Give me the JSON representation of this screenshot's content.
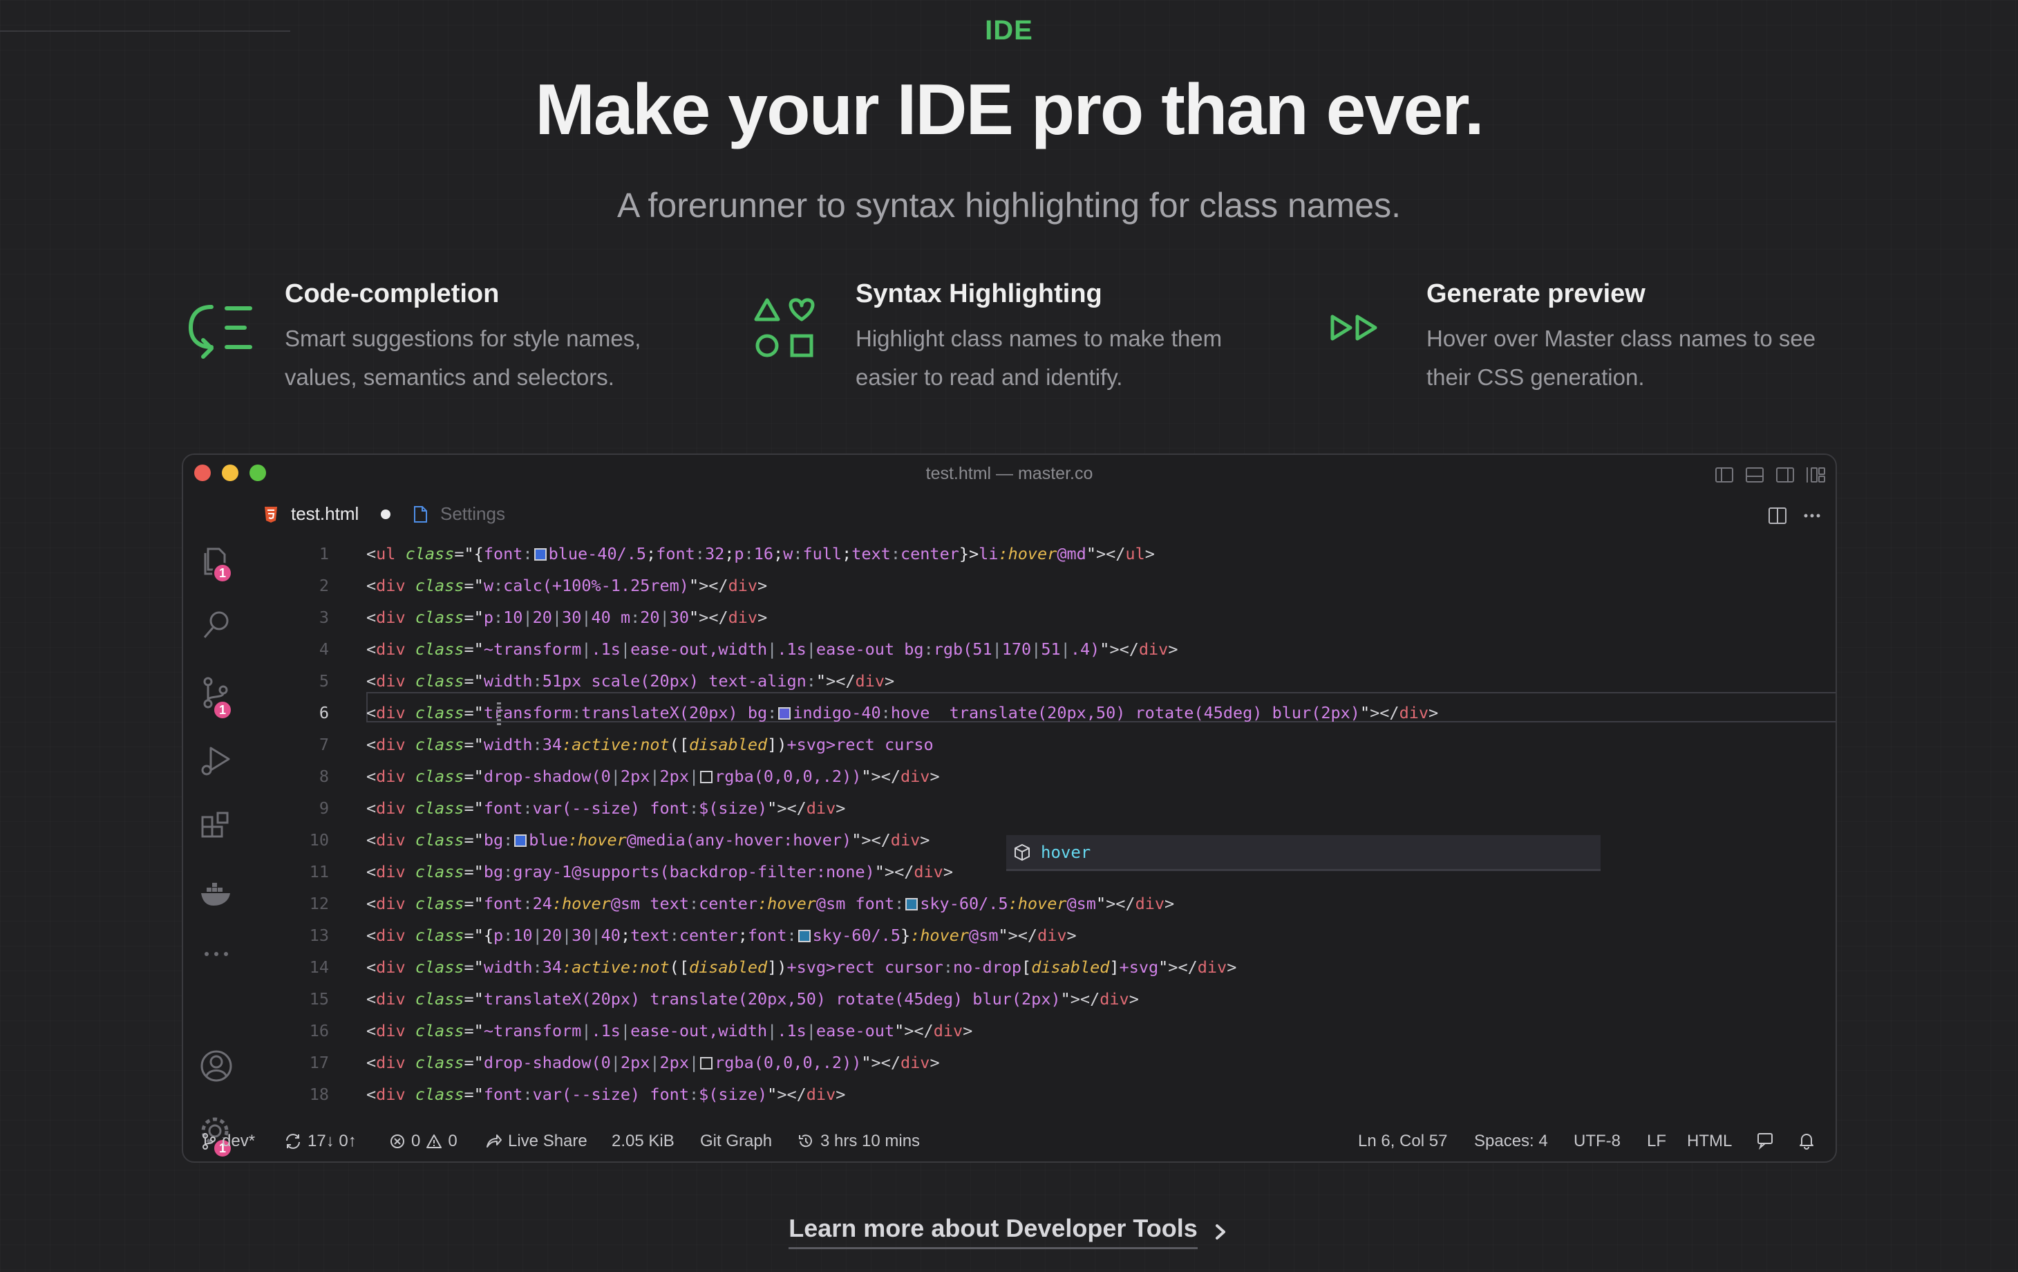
{
  "hero": {
    "eyebrow": "IDE",
    "title": "Make your IDE pro than ever.",
    "subtitle": "A forerunner to syntax highlighting for class names."
  },
  "features": [
    {
      "icon": "code-completion-icon",
      "title": "Code-completion",
      "desc": "Smart suggestions for style names, values, semantics and selectors."
    },
    {
      "icon": "shapes-icon",
      "title": "Syntax Highlighting",
      "desc": "Highlight class names to make them easier to read and identify."
    },
    {
      "icon": "fast-forward-icon",
      "title": "Generate preview",
      "desc": "Hover over Master class names to see their CSS generation."
    }
  ],
  "editor": {
    "window_title": "test.html — master.co",
    "tabs": [
      {
        "label": "test.html",
        "icon": "html-file-icon",
        "modified": true
      },
      {
        "label": "Settings",
        "icon": "settings-file-icon"
      }
    ],
    "activity_badges": {
      "explorer": "1",
      "source_control": "1",
      "settings": "1"
    },
    "current_line": 6,
    "suggestion": "hover",
    "colors": {
      "accent": "#4cc064",
      "badge": "#e5508e",
      "tag": "#e06b74",
      "attr": "#8fd66f",
      "value": "#d183e8",
      "state": "#e5b94f"
    }
  },
  "status": {
    "branch": "dev*",
    "sync": "17↓ 0↑",
    "errors": "0",
    "warnings": "0",
    "live_share": "Live Share",
    "size": "2.05 KiB",
    "git_graph": "Git Graph",
    "time": "3 hrs 10 mins",
    "position": "Ln 6, Col 57",
    "spaces": "Spaces: 4",
    "encoding": "UTF-8",
    "eol": "LF",
    "language": "HTML"
  },
  "learn_more": "Learn more about Developer Tools"
}
